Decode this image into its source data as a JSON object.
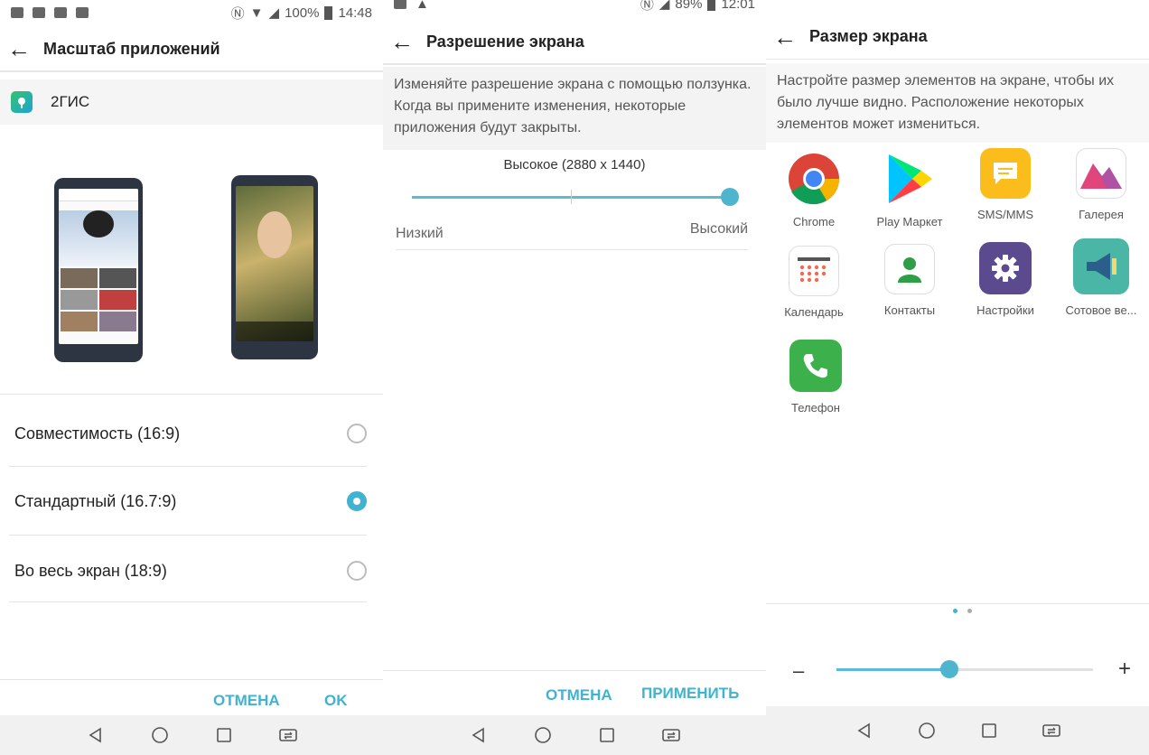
{
  "left": {
    "status": {
      "right_text": "100%",
      "time": "14:48"
    },
    "title": "Масштаб приложений",
    "app": {
      "name": "2ГИС"
    },
    "options": [
      {
        "label": "Совместимость (16:9)",
        "selected": false
      },
      {
        "label": "Стандартный (16.7:9)",
        "selected": true
      },
      {
        "label": "Во весь экран (18:9)",
        "selected": false
      }
    ],
    "buttons": {
      "cancel": "ОТМЕНА",
      "ok": "OK"
    }
  },
  "middle": {
    "status": {
      "right_text": "89%",
      "time": "12:01"
    },
    "title": "Разрешение экрана",
    "description": "Изменяйте разрешение экрана с помощью ползунка. Когда вы примените изменения, некоторые приложения будут закрыты.",
    "slider": {
      "value_label": "Высокое (2880 x 1440)",
      "min_label": "Низкий",
      "max_label": "Высокий",
      "level": 1.0
    },
    "buttons": {
      "cancel": "ОТМЕНА",
      "apply": "ПРИМЕНИТЬ"
    }
  },
  "right": {
    "title": "Размер экрана",
    "description": "Настройте размер элементов на экране, чтобы их было лучше видно. Расположение некоторых элементов может измениться.",
    "apps": [
      {
        "label": "Chrome",
        "icon": "chrome-icon"
      },
      {
        "label": "Play Маркет",
        "icon": "play-market-icon"
      },
      {
        "label": "SMS/MMS",
        "icon": "messages-icon"
      },
      {
        "label": "Галерея",
        "icon": "gallery-icon"
      },
      {
        "label": "Календарь",
        "icon": "calendar-icon"
      },
      {
        "label": "Контакты",
        "icon": "contacts-icon"
      },
      {
        "label": "Настройки",
        "icon": "settings-icon"
      },
      {
        "label": "Сотовое ве...",
        "icon": "cell-broadcast-icon"
      },
      {
        "label": "Телефон",
        "icon": "phone-icon"
      }
    ],
    "page_indicator": {
      "current": 1,
      "total": 2
    },
    "size_slider": {
      "minus": "–",
      "plus": "+",
      "level": 0.5
    }
  },
  "colors": {
    "accent": "#3fb3cf"
  }
}
